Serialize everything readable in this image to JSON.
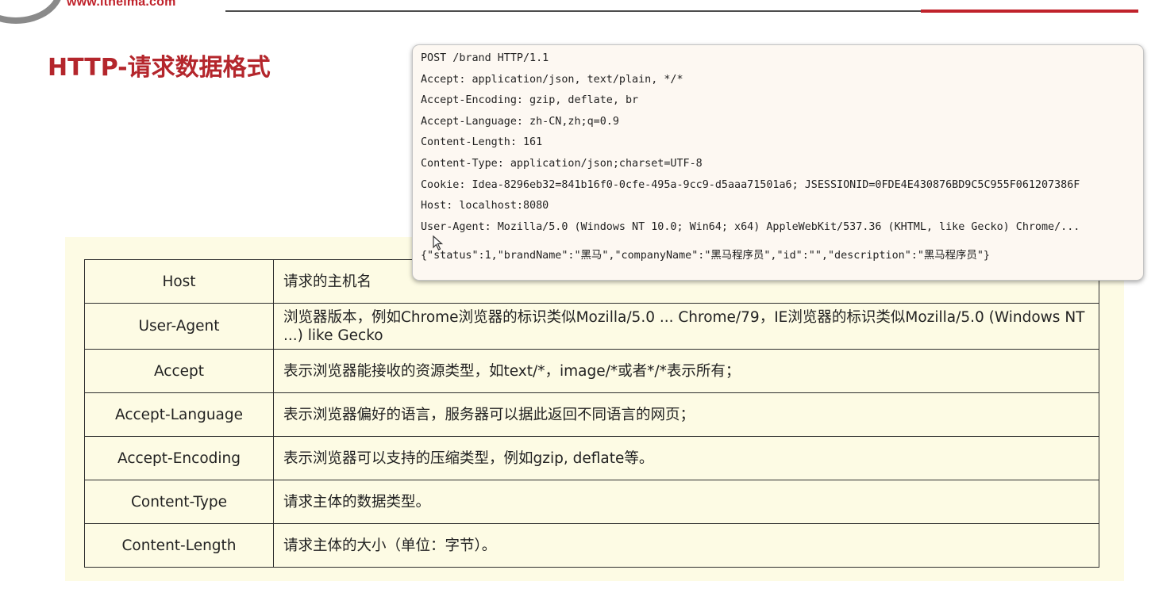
{
  "header": {
    "site_url": "www.itheima.com",
    "accent_color": "#c0222b"
  },
  "page_title": "HTTP-请求数据格式",
  "http_request": {
    "lines": [
      "POST /brand HTTP/1.1",
      "Accept: application/json, text/plain, */*",
      "Accept-Encoding: gzip, deflate, br",
      "Accept-Language: zh-CN,zh;q=0.9",
      "Content-Length: 161",
      "Content-Type: application/json;charset=UTF-8",
      "Cookie: Idea-8296eb32=841b16f0-0cfe-495a-9cc9-d5aaa71501a6; JSESSIONID=0FDE4E430876BD9C5C955F061207386F",
      "Host: localhost:8080",
      "User-Agent: Mozilla/5.0 (Windows NT 10.0; Win64; x64) AppleWebKit/537.36 (KHTML, like Gecko) Chrome/..."
    ],
    "body": "{\"status\":1,\"brandName\":\"黑马\",\"companyName\":\"黑马程序员\",\"id\":\"\",\"description\":\"黑马程序员\"}"
  },
  "table": {
    "rows": [
      {
        "name": "Host",
        "desc": "请求的主机名"
      },
      {
        "name": "User-Agent",
        "desc": "浏览器版本，例如Chrome浏览器的标识类似Mozilla/5.0 ... Chrome/79，IE浏览器的标识类似Mozilla/5.0 (Windows NT ...) like Gecko"
      },
      {
        "name": "Accept",
        "desc": "表示浏览器能接收的资源类型，如text/*，image/*或者*/*表示所有；"
      },
      {
        "name": "Accept-Language",
        "desc": "表示浏览器偏好的语言，服务器可以据此返回不同语言的网页；"
      },
      {
        "name": "Accept-Encoding",
        "desc": "表示浏览器可以支持的压缩类型，例如gzip, deflate等。"
      },
      {
        "name": "Content-Type",
        "desc": "请求主体的数据类型。"
      },
      {
        "name": "Content-Length",
        "desc": "请求主体的大小（单位：字节）。"
      }
    ]
  }
}
